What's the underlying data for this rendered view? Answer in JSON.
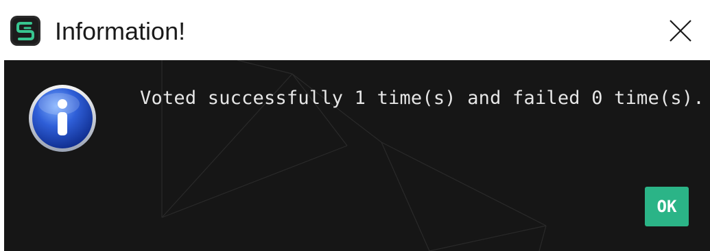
{
  "window": {
    "title": "Information!"
  },
  "dialog": {
    "message": "Voted successfully 1 time(s) and failed 0 time(s).",
    "ok_label": "OK"
  },
  "colors": {
    "content_background": "#161616",
    "ok_button": "#2bb487",
    "message_text": "#e6e6e6"
  },
  "icons": {
    "app": "app-logo-icon",
    "close": "close-icon",
    "info": "info-icon"
  }
}
